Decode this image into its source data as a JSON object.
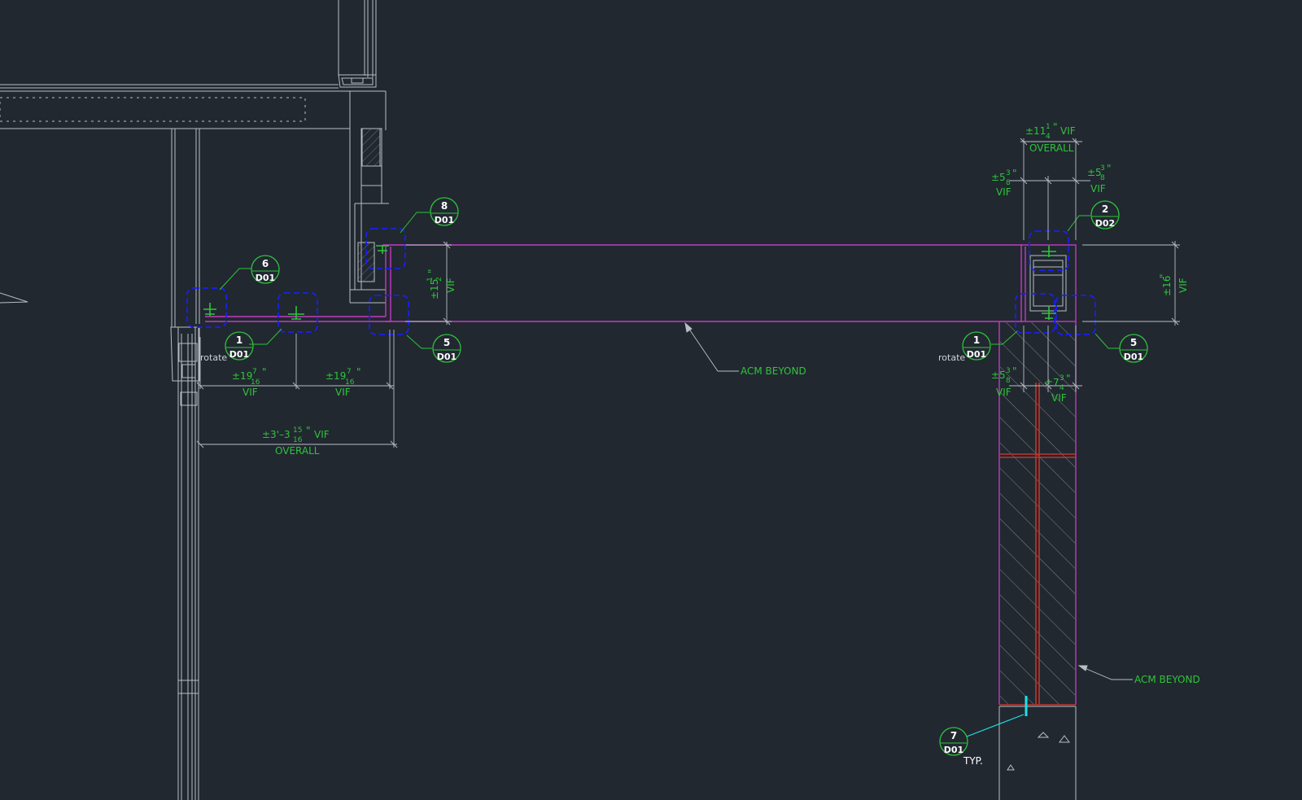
{
  "colors": {
    "background": "#212830",
    "linework": "#b9bec3",
    "panel": "#c43ac2",
    "callout_box": "#1a1ff0",
    "annotation": "#2fc43b",
    "hatch": "#7e8488",
    "red_line": "#c0362c",
    "cyan_marker": "#1fe0e8"
  },
  "detail_bubbles": [
    {
      "number": "8",
      "sheet": "D01"
    },
    {
      "number": "6",
      "sheet": "D01"
    },
    {
      "number": "1",
      "sheet": "D01"
    },
    {
      "number": "5",
      "sheet": "D01"
    },
    {
      "number": "2",
      "sheet": "D02"
    },
    {
      "number": "1",
      "sheet": "D01"
    },
    {
      "number": "5",
      "sheet": "D01"
    },
    {
      "number": "7",
      "sheet": "D01"
    }
  ],
  "notes": {
    "acm_beyond_horizontal": "ACM  BEYOND",
    "acm_beyond_vertical": "ACM  BEYOND",
    "rotate_left": "rotate",
    "rotate_right": "rotate",
    "typ": "TYP."
  },
  "dimensions": {
    "left_19_a": {
      "whole": "±19",
      "num": "7",
      "den": "16",
      "unit": "\"",
      "tag": "VIF"
    },
    "left_19_b": {
      "whole": "±19",
      "num": "7",
      "den": "16",
      "unit": "\"",
      "tag": "VIF"
    },
    "left_overall": {
      "whole": "±3'–3",
      "num": "15",
      "den": "16",
      "unit": "\"",
      "tag": "VIF",
      "label": "OVERALL"
    },
    "left_vertical": {
      "whole": "±15",
      "num": "1",
      "den": "2",
      "unit": "\"",
      "tag": "VIF"
    },
    "right_overall": {
      "whole": "±11",
      "num": "1",
      "den": "4",
      "unit": "\"",
      "tag": "VIF",
      "label": "OVERALL"
    },
    "right_top_a": {
      "whole": "±5",
      "num": "3",
      "den": "8",
      "unit": "\"",
      "tag": "VIF"
    },
    "right_top_b": {
      "whole": "±5",
      "num": "3",
      "den": "8",
      "unit": "\"",
      "tag": "VIF"
    },
    "right_vertical": {
      "whole": "±16",
      "unit": "\"",
      "tag": "VIF"
    },
    "right_bottom_a": {
      "whole": "±5",
      "num": "3",
      "den": "8",
      "unit": "\"",
      "tag": "VIF"
    },
    "right_bottom_b": {
      "whole": "±7",
      "num": "3",
      "den": "4",
      "unit": "\"",
      "tag": "VIF"
    }
  }
}
